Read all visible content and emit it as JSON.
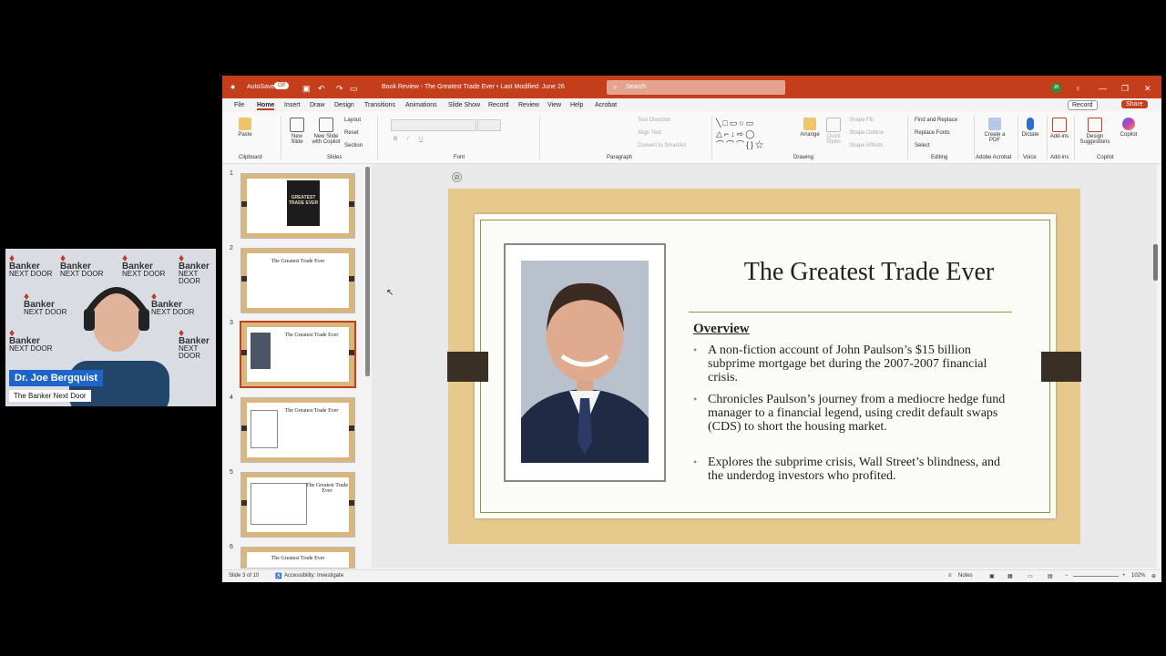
{
  "webcam": {
    "name": "Dr. Joe Bergquist",
    "subtitle": "The Banker Next Door",
    "logo_top": "Banker",
    "logo_bottom": "NEXT DOOR"
  },
  "titlebar": {
    "autosave_label": "AutoSave",
    "autosave_state": "Off",
    "doc_title": "Book Review - The Greatest Trade Ever • Last Modified: June 26",
    "search_placeholder": "Search",
    "avatar_initials": "JB",
    "record_label": "Record",
    "share_label": "Share"
  },
  "ribbon_tabs": [
    "File",
    "Home",
    "Insert",
    "Draw",
    "Design",
    "Transitions",
    "Animations",
    "Slide Show",
    "Record",
    "Review",
    "View",
    "Help",
    "Acrobat"
  ],
  "ribbon": {
    "paste": "Paste",
    "new_slide": "New Slide",
    "new_slide_copilot": "New Slide with Copilot",
    "layout": "Layout",
    "reset": "Reset",
    "section": "Section",
    "text_direction": "Text Direction",
    "align_text": "Align Text",
    "convert_smartart": "Convert to SmartArt",
    "arrange": "Arrange",
    "quick_styles": "Quick Styles",
    "shape_fill": "Shape Fill",
    "shape_outline": "Shape Outline",
    "shape_effects": "Shape Effects",
    "find_replace": "Find and Replace",
    "replace_fonts": "Replace Fonts",
    "select": "Select",
    "create_pdf": "Create a PDF",
    "dictate": "Dictate",
    "addins": "Add-ins",
    "design_suggestions": "Design Suggestions",
    "copilot": "Copilot",
    "groups": {
      "clipboard": "Clipboard",
      "slides": "Slides",
      "font": "Font",
      "paragraph": "Paragraph",
      "drawing": "Drawing",
      "editing": "Editing",
      "adobe_acrobat": "Adobe Acrobat",
      "voice": "Voice",
      "addins": "Add-ins",
      "copilot": "Copilot"
    }
  },
  "thumbnails": [
    {
      "num": "1",
      "title": "GREATEST TRADE EVER",
      "selected": false
    },
    {
      "num": "2",
      "title": "The Greatest Trade Ever",
      "selected": false
    },
    {
      "num": "3",
      "title": "The Greatest Trade Ever",
      "selected": true
    },
    {
      "num": "4",
      "title": "The Greatest Trade Ever",
      "selected": false
    },
    {
      "num": "5",
      "title": "The Greatest Trade Ever",
      "selected": false
    },
    {
      "num": "6",
      "title": "The Greatest Trade Ever",
      "selected": false
    }
  ],
  "slide": {
    "title": "The Greatest Trade Ever",
    "heading": "Overview",
    "bullets": [
      "A non-fiction account of John Paulson’s $15 billion subprime mortgage bet during the 2007-2007 financial crisis.",
      "Chronicles Paulson’s journey from a mediocre hedge fund manager to a financial legend, using credit default swaps (CDS) to short the housing market.",
      "Explores the subprime crisis, Wall Street’s blindness, and the underdog investors who profited."
    ]
  },
  "statusbar": {
    "slide_info": "Slide 3 of 10",
    "accessibility": "Accessibility: Investigate",
    "notes": "Notes",
    "zoom": "102%"
  },
  "colors": {
    "accent": "#c43e1c",
    "slide_wood": "#e7c98e",
    "slide_rule": "#8a9a3a"
  }
}
